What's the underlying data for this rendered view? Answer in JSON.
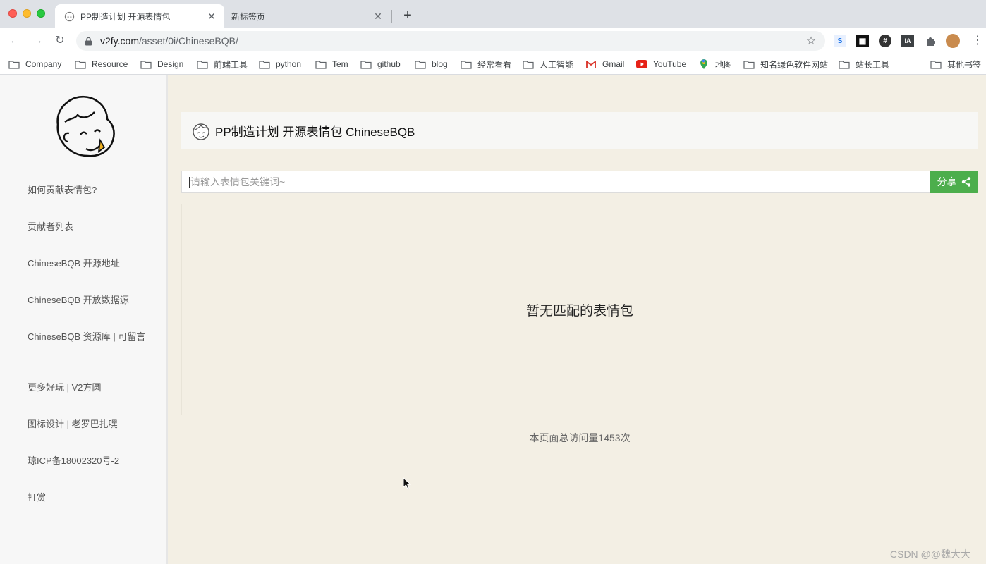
{
  "browser": {
    "tabs": [
      {
        "title": "PP制造计划 开源表情包",
        "active": true
      },
      {
        "title": "新标签页",
        "active": false
      }
    ],
    "url": {
      "domain": "v2fy.com",
      "path": "/asset/0i/ChineseBQB/"
    },
    "extensions": [
      "S",
      "▣",
      "#",
      "IA",
      "puzzle"
    ],
    "bookmarks": [
      {
        "label": "Company",
        "icon": "folder-icon"
      },
      {
        "label": "Resource",
        "icon": "folder-icon"
      },
      {
        "label": "Design",
        "icon": "folder-icon"
      },
      {
        "label": "前端工具",
        "icon": "folder-icon"
      },
      {
        "label": "python",
        "icon": "folder-icon"
      },
      {
        "label": "Tem",
        "icon": "folder-icon"
      },
      {
        "label": "github",
        "icon": "folder-icon"
      },
      {
        "label": "blog",
        "icon": "folder-icon"
      },
      {
        "label": "经常看看",
        "icon": "folder-icon"
      },
      {
        "label": "人工智能",
        "icon": "folder-icon"
      },
      {
        "label": "Gmail",
        "icon": "gmail-icon"
      },
      {
        "label": "YouTube",
        "icon": "youtube-icon"
      },
      {
        "label": "地图",
        "icon": "maps-icon"
      },
      {
        "label": "知名绿色软件网站",
        "icon": "folder-icon"
      },
      {
        "label": "站长工具",
        "icon": "folder-icon"
      }
    ],
    "other_bookmarks": "其他书签"
  },
  "sidebar": {
    "items": [
      "如何贡献表情包?",
      "贡献者列表",
      "ChineseBQB 开源地址",
      "ChineseBQB 开放数据源",
      "ChineseBQB 资源库 | 可留言",
      "更多好玩 | V2方圆",
      "图标设计 | 老罗巴扎嘿",
      "琼ICP备18002320号-2",
      "打赏"
    ]
  },
  "main": {
    "title": "PP制造计划 开源表情包 ChineseBQB",
    "search_placeholder": "请输入表情包关键词~",
    "share_label": "分享",
    "empty_message": "暂无匹配的表情包",
    "visits": "本页面总访问量1453次"
  },
  "watermark": "CSDN @@魏大大",
  "colors": {
    "accent": "#4cae4c",
    "page_bg": "#f3efe4",
    "sidebar_bg": "#f7f7f7"
  }
}
